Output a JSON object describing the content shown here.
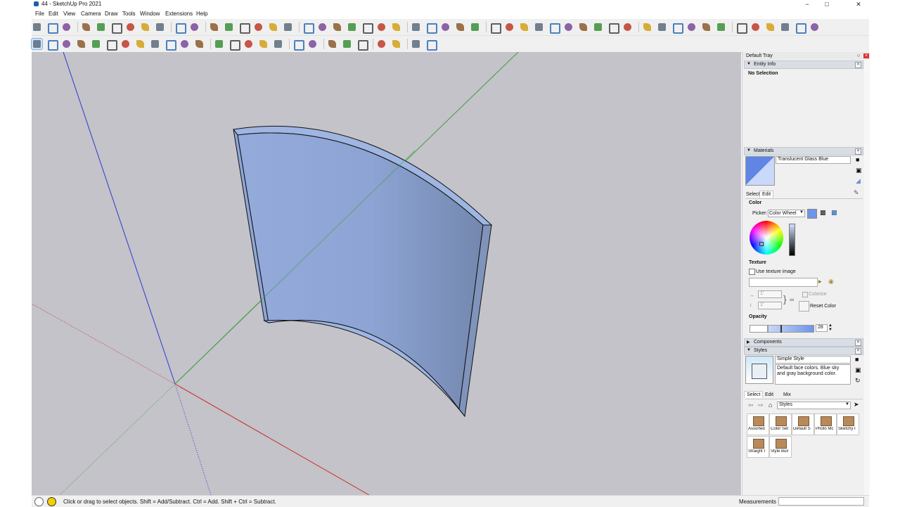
{
  "window": {
    "title": "44 - SketchUp Pro 2021",
    "minimize": "−",
    "restore": "□",
    "close": "✕"
  },
  "menu": [
    "File",
    "Edit",
    "View",
    "Camera",
    "Draw",
    "Tools",
    "Window",
    "Extensions",
    "Help"
  ],
  "colors": {
    "accent": "#1f5fa8",
    "glass": "#8fa9dc",
    "axis_red": "#c8322a",
    "axis_green": "#3f9e3f",
    "axis_blue": "#2b3ad1",
    "viewport_bg": "#c3c3c9"
  },
  "tray": {
    "title": "Default Tray",
    "entity_info": {
      "header": "Entity Info",
      "selection": "No Selection"
    },
    "materials": {
      "header": "Materials",
      "name": "Translucent Glass Blue",
      "tabs": [
        "Select",
        "Edit"
      ],
      "color_label": "Color",
      "picker_label": "Picker:",
      "picker_value": "Color Wheel",
      "texture_label": "Texture",
      "use_texture": "Use texture image",
      "width": "1'",
      "height": "1'",
      "colorize": "Colorize",
      "reset_color": "Reset Color",
      "opacity_label": "Opacity",
      "opacity_value": "28",
      "opacity_fraction": 0.28
    },
    "components": {
      "header": "Components"
    },
    "styles": {
      "header": "Styles",
      "name": "Simple Style",
      "description": "Default face colors. Blue sky and gray background color.",
      "tabs": [
        "Select",
        "Edit",
        "Mix"
      ],
      "collection": "Styles",
      "thumbs": [
        "Assorted",
        "Color Set",
        "Default S",
        "Photo Mc",
        "Sketchy I",
        "Straight I",
        "Style Buil"
      ]
    }
  },
  "status": {
    "hint": "Click or drag to select objects. Shift = Add/Subtract. Ctrl = Add. Shift + Ctrl = Subtract.",
    "measurements": "Measurements"
  },
  "icons": {
    "toolbar1": [
      "new-icon",
      "open-icon",
      "save-icon",
      "cut-icon",
      "copy-icon",
      "paste-icon",
      "erase-icon",
      "undo-icon",
      "redo-icon",
      "print-icon",
      "model-info-icon",
      "iso-view-icon",
      "top-view-icon",
      "front-view-icon",
      "right-view-icon",
      "back-view-icon",
      "left-view-icon",
      "xray-icon",
      "back-edges-icon",
      "wireframe-icon",
      "hidden-line-icon",
      "shaded-icon",
      "textured-icon",
      "monochrome-icon",
      "warehouse-icon",
      "share-model-icon",
      "extension-warehouse-icon",
      "send-to-layout-icon",
      "extension-manager-icon",
      "line-icon",
      "freehand-icon",
      "rectangle-icon",
      "rotated-rectangle-icon",
      "circle-icon",
      "polygon-icon",
      "arc-icon",
      "two-point-arc-icon",
      "three-point-arc-icon",
      "pie-icon",
      "move-icon",
      "push-pull-icon",
      "rotate-icon",
      "follow-me-icon",
      "scale-icon",
      "offset-icon",
      "tape-measure-icon",
      "dimension-icon",
      "protractor-icon",
      "text-icon",
      "axes-icon",
      "3d-text-icon"
    ],
    "toolbar2": [
      "select-icon",
      "eraser-icon",
      "line-icon",
      "arc-icon",
      "shape-icon",
      "push-pull-icon",
      "offset-icon",
      "move-icon",
      "rotate-icon",
      "scale-icon",
      "tape-measure-icon",
      "paint-bucket-icon",
      "orbit-icon",
      "pan-icon",
      "zoom-icon",
      "zoom-extents-icon",
      "position-camera-icon",
      "walk-icon",
      "look-around-icon",
      "section-plane-icon",
      "display-section-icon",
      "advanced-camera-icon",
      "solid-tools-icon",
      "sandbox-icon",
      "sandbox-smoove-icon",
      "dynamic-components-icon"
    ]
  }
}
